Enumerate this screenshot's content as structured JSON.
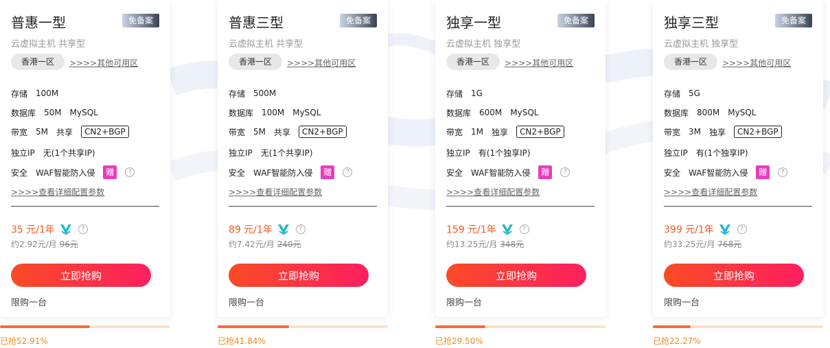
{
  "plans": [
    {
      "title": "普惠一型",
      "badge": "免备案",
      "subtitle": "云虚拟主机 共享型",
      "region": "香港一区",
      "other_regions": ">>>>其他可用区",
      "storage_label": "存储",
      "storage_value": "100M",
      "db_label": "数据库",
      "db_value": "50M",
      "db_type": "MySQL",
      "bw_label": "带宽",
      "bw_value": "5M",
      "bw_type": "共享",
      "bw_tag": "CN2+BGP",
      "ip_label": "独立IP",
      "ip_value": "无(1个共享IP)",
      "sec_label": "安全",
      "sec_value": "WAF智能防入侵",
      "gift": "赠",
      "detail_link": ">>>>查看详细配置参数",
      "price": "35 元/1年",
      "monthly": "约2.92元/月",
      "original": "96元",
      "buy_label": "立即抢购",
      "limit": "限购一台",
      "sold_text": "已抢52.91%",
      "sold_percent": 52.91
    },
    {
      "title": "普惠三型",
      "badge": "免备案",
      "subtitle": "云虚拟主机 共享型",
      "region": "香港一区",
      "other_regions": ">>>>其他可用区",
      "storage_label": "存储",
      "storage_value": "500M",
      "db_label": "数据库",
      "db_value": "100M",
      "db_type": "MySQL",
      "bw_label": "带宽",
      "bw_value": "5M",
      "bw_type": "共享",
      "bw_tag": "CN2+BGP",
      "ip_label": "独立IP",
      "ip_value": "无(1个共享IP)",
      "sec_label": "安全",
      "sec_value": "WAF智能防入侵",
      "gift": "赠",
      "detail_link": ">>>>查看详细配置参数",
      "price": "89 元/1年",
      "monthly": "约7.42元/月",
      "original": "240元",
      "buy_label": "立即抢购",
      "limit": "限购一台",
      "sold_text": "已抢41.84%",
      "sold_percent": 41.84
    },
    {
      "title": "独享一型",
      "badge": "免备案",
      "subtitle": "云虚拟主机 独享型",
      "region": "香港一区",
      "other_regions": ">>>>其他可用区",
      "storage_label": "存储",
      "storage_value": "1G",
      "db_label": "数据库",
      "db_value": "600M",
      "db_type": "MySQL",
      "bw_label": "带宽",
      "bw_value": "1M",
      "bw_type": "独享",
      "bw_tag": "CN2+BGP",
      "ip_label": "独立IP",
      "ip_value": "有(1个独享IP)",
      "sec_label": "安全",
      "sec_value": "WAF智能防入侵",
      "gift": "赠",
      "detail_link": ">>>>查看详细配置参数",
      "price": "159 元/1年",
      "monthly": "约13.25元/月",
      "original": "348元",
      "buy_label": "立即抢购",
      "limit": "限购一台",
      "sold_text": "已抢29.50%",
      "sold_percent": 29.5
    },
    {
      "title": "独享三型",
      "badge": "免备案",
      "subtitle": "云虚拟主机 独享型",
      "region": "香港一区",
      "other_regions": ">>>>其他可用区",
      "storage_label": "存储",
      "storage_value": "5G",
      "db_label": "数据库",
      "db_value": "800M",
      "db_type": "MySQL",
      "bw_label": "带宽",
      "bw_value": "3M",
      "bw_type": "独享",
      "bw_tag": "CN2+BGP",
      "ip_label": "独立IP",
      "ip_value": "有(1个独享IP)",
      "sec_label": "安全",
      "sec_value": "WAF智能防入侵",
      "gift": "赠",
      "detail_link": ">>>>查看详细配置参数",
      "price": "399 元/1年",
      "monthly": "约33.25元/月",
      "original": "768元",
      "buy_label": "立即抢购",
      "limit": "限购一台",
      "sold_text": "已抢22.27%",
      "sold_percent": 22.27
    }
  ],
  "colors": {
    "price": "#f05a24",
    "buy_gradient_start": "#fa4b26",
    "buy_gradient_end": "#fd1f5f",
    "progress_fill": "#f56a3a",
    "progress_track": "#fde1c5",
    "sold_text": "#ef8a1f",
    "gift_bg": "#e53dbd",
    "vip_icon": "#20b8c8"
  }
}
